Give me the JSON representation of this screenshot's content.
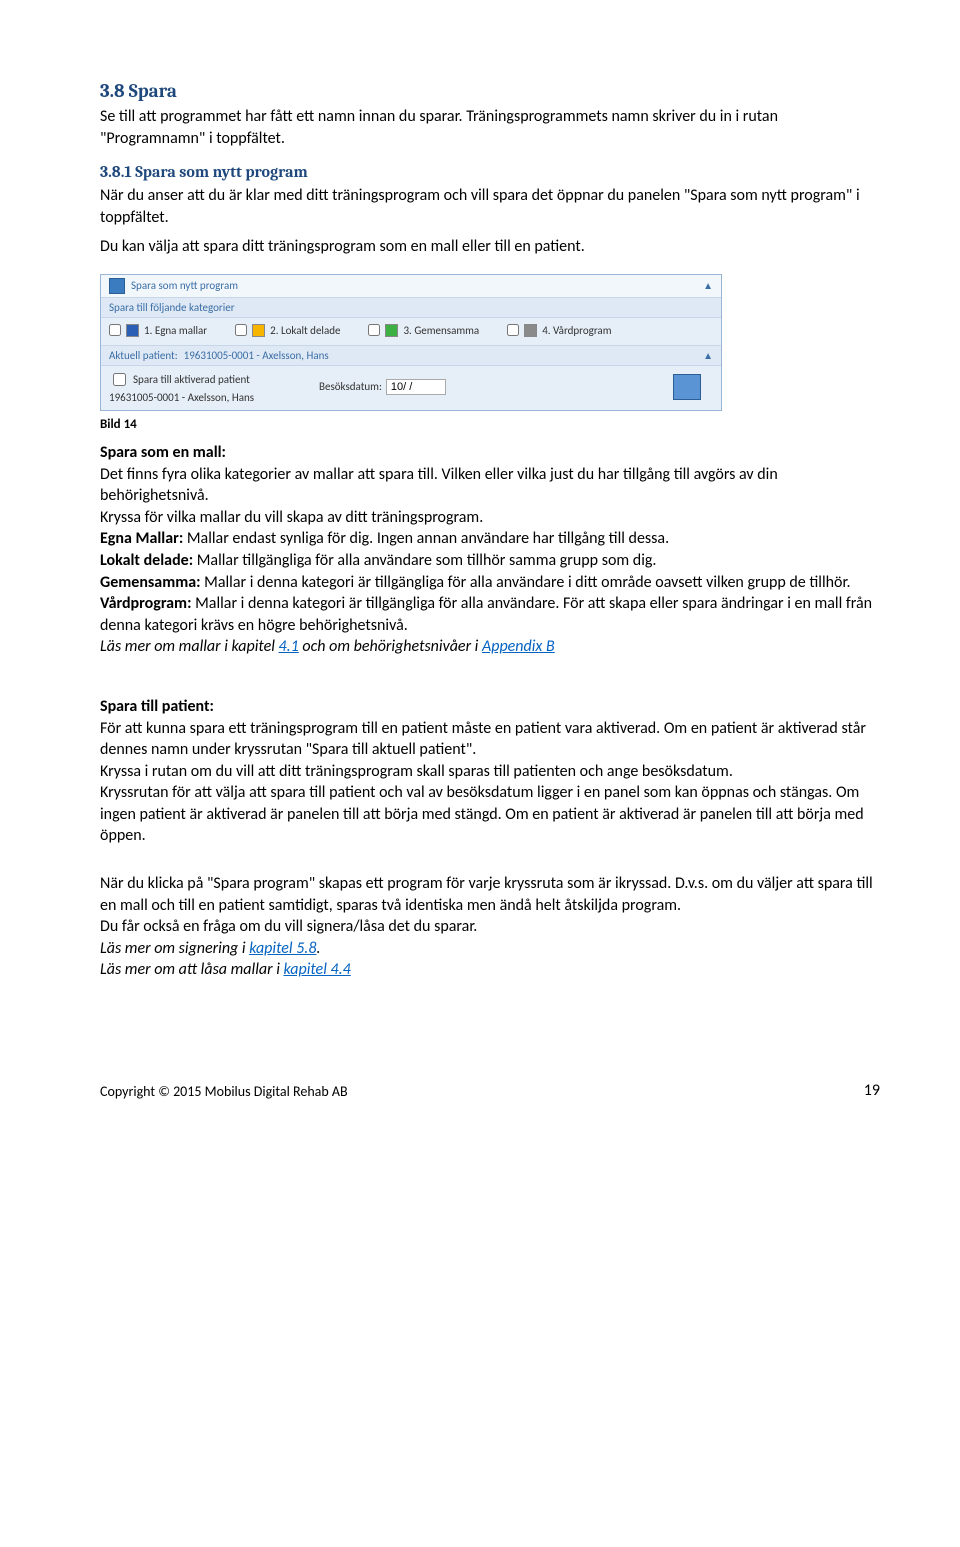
{
  "section": {
    "h3": "3.8 Spara",
    "intro_p1": "Se till att programmet har fått ett namn innan du sparar. Träningsprogrammets namn skriver du in i rutan \"Programnamn\" i toppfältet.",
    "h4": "3.8.1 Spara som nytt program",
    "p_h4_1": "När du anser att du är klar med ditt träningsprogram och vill spara det öppnar du panelen \"Spara som nytt program\" i toppfältet.",
    "p_h4_2": "Du kan välja att spara ditt träningsprogram som en mall eller till en patient."
  },
  "panel": {
    "header_title": "Spara som nytt program",
    "section_title": "Spara till följande kategorier",
    "categories": [
      {
        "color": "#2a5fb5",
        "label": "1. Egna mallar"
      },
      {
        "color": "#f7b500",
        "label": "2. Lokalt delade"
      },
      {
        "color": "#3cb043",
        "label": "3. Gemensamma"
      },
      {
        "color": "#8a8a8a",
        "label": "4. Vårdprogram"
      }
    ],
    "patient_label": "Aktuell patient:",
    "patient_value": "19631005-0001 - Axelsson, Hans",
    "save_to_patient_label": "Spara till aktiverad patient",
    "patient_line": "19631005-0001 - Axelsson, Hans",
    "visit_date_label": "Besöksdatum:",
    "visit_date_value": "10/ /"
  },
  "caption": "Bild 14",
  "mall": {
    "heading": "Spara som en mall:",
    "p1": "Det finns fyra olika kategorier av mallar att spara till. Vilken eller vilka just du har tillgång till avgörs av din behörighetsnivå.",
    "p2": "Kryssa för vilka mallar du vill skapa av ditt träningsprogram.",
    "egna_label": "Egna Mallar:",
    "egna_text": " Mallar endast synliga för dig. Ingen annan användare har tillgång till dessa.",
    "lokalt_label": "Lokalt delade:",
    "lokalt_text": " Mallar tillgängliga för alla användare som tillhör samma grupp som dig.",
    "gem_label": "Gemensamma:",
    "gem_text": " Mallar i denna kategori är tillgängliga för alla användare i ditt område oavsett vilken grupp de tillhör.",
    "vard_label": "Vårdprogram:",
    "vard_text": " Mallar i denna kategori är tillgängliga för alla användare. För att skapa eller spara ändringar i en mall från denna kategori krävs en högre behörighetsnivå.",
    "read_more_prefix": "Läs mer om mallar i kapitel ",
    "read_more_link1": "4.1",
    "read_more_mid": " och om behörighetsnivåer i  ",
    "read_more_link2": "Appendix B"
  },
  "patient": {
    "heading": "Spara till patient:",
    "p1": "För att kunna spara ett träningsprogram till en patient måste en patient vara aktiverad. Om en patient är aktiverad står dennes namn under kryssrutan \"Spara till aktuell patient\".",
    "p2": "Kryssa i rutan om du vill att ditt träningsprogram skall sparas till patienten och ange besöksdatum.",
    "p3": "Kryssrutan för att välja att spara till patient och val av besöksdatum ligger i en panel som kan öppnas och stängas. Om ingen patient är aktiverad är panelen till att börja med stängd. Om en patient är aktiverad är panelen till att börja med öppen.",
    "p4": "När du klicka på \"Spara program\" skapas ett program för varje kryssruta som är ikryssad. D.v.s. om du väljer att spara till en mall och till en patient samtidigt, sparas två identiska men ändå helt åtskiljda program.",
    "p5": "Du får också en fråga om du vill signera/låsa det du sparar.",
    "sign_prefix": "Läs mer om signering i ",
    "sign_link": "kapitel 5.8",
    "sign_suffix": ".",
    "lock_prefix": "Läs mer om att låsa mallar i ",
    "lock_link": "kapitel 4.4"
  },
  "footer": {
    "copyright": "Copyright © 2015 Mobilus Digital Rehab AB",
    "page": "19"
  }
}
